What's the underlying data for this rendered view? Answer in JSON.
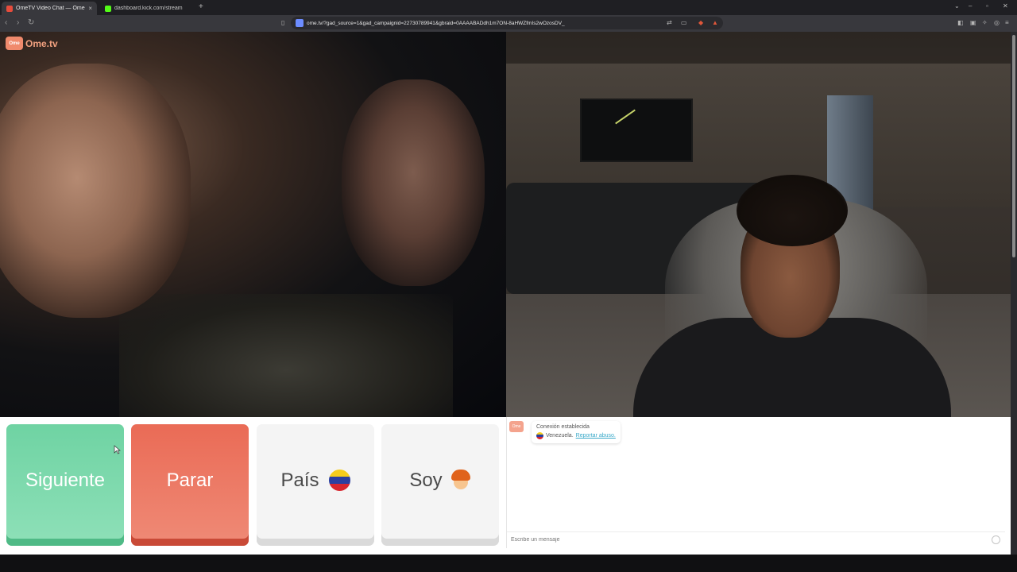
{
  "browser": {
    "tabs": [
      {
        "title": "OmeTV Video Chat — Omeg",
        "active": true,
        "favicon_color": "#e74c3c"
      },
      {
        "title": "dashboard.kick.com/stream",
        "active": false,
        "favicon_color": "#53fc18"
      }
    ],
    "new_tab": "+",
    "tab_close": "×",
    "window_controls": {
      "chevron": "⌄",
      "minimize": "–",
      "restore": "▫",
      "close": "✕"
    },
    "nav": {
      "back": "‹",
      "forward": "›",
      "reload": "↻"
    },
    "url": "ome.tv/?gad_source=1&gad_campaignid=22730789941&gbraid=0AAAABADdh1m7ON-8aHWZfmIs2wOzosDV_"
  },
  "page": {
    "logo_badge": "Ome",
    "logo_text": "Ome.tv",
    "buttons": {
      "next": "Siguiente",
      "stop": "Parar",
      "country": "País",
      "gender": "Soy"
    },
    "chat": {
      "logo": "Ome",
      "status": "Conexión establecida",
      "country": "Venezuela.",
      "report": "Reportar abuso.",
      "input_placeholder": "Escribe un mensaje"
    }
  },
  "colors": {
    "next": "#6fd3a3",
    "stop": "#ea6b56",
    "link": "#39a9c9"
  }
}
